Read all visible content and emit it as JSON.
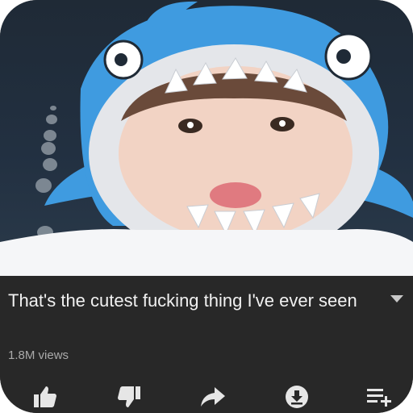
{
  "video": {
    "thumbnail": "person-in-blue-shark-hood"
  },
  "details": {
    "title": "That's the cutest fucking thing I've ever seen",
    "views": "1.8M views",
    "expand_icon": "chevron-down-icon"
  },
  "actions": [
    {
      "name": "like-button",
      "icon": "thumbs-up-icon"
    },
    {
      "name": "dislike-button",
      "icon": "thumbs-down-icon"
    },
    {
      "name": "share-button",
      "icon": "share-arrow-icon"
    },
    {
      "name": "download-button",
      "icon": "download-icon"
    },
    {
      "name": "save-to-playlist-button",
      "icon": "playlist-add-icon"
    }
  ],
  "colors": {
    "panel_bg": "#282828",
    "title_text": "#f1f1f1",
    "meta_text": "#aaaaaa",
    "icon": "#e6e6e6",
    "shark_blue": "#3f9be0"
  }
}
